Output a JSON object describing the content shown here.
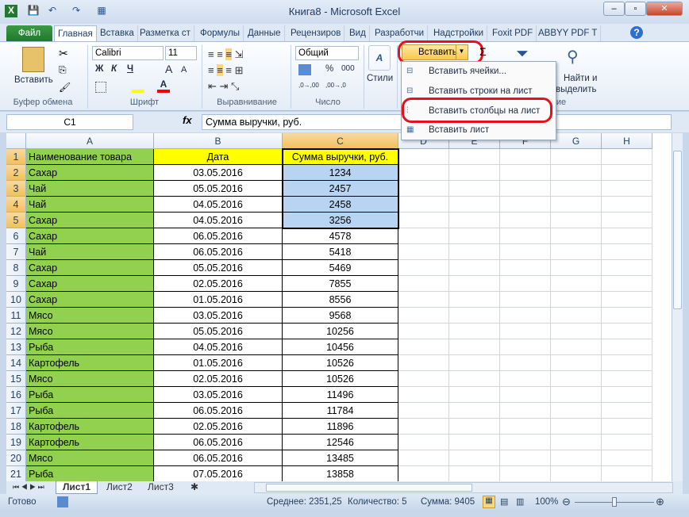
{
  "window": {
    "title": "Книга8 - Microsoft Excel",
    "minimize": "‒",
    "maximize": "▫",
    "close": "✕"
  },
  "qat": {
    "excel_icon": "X",
    "save": "💾",
    "undo": "↶",
    "redo": "↷",
    "form": "▦"
  },
  "tabs": [
    "Файл",
    "Главная",
    "Вставка",
    "Разметка ст",
    "Формулы",
    "Данные",
    "Рецензиров",
    "Вид",
    "Разработчи",
    "Надстройки",
    "Foxit PDF",
    "ABBYY PDF T"
  ],
  "ribbon": {
    "clipboard": {
      "paste": "Вставить",
      "group": "Буфер обмена"
    },
    "font": {
      "name": "Calibri",
      "size": "11",
      "bold": "Ж",
      "italic": "К",
      "underline": "Ч",
      "grow": "A",
      "shrink": "A",
      "group": "Шрифт",
      "fill_color": "#ffff00",
      "font_color": "#ff0000"
    },
    "alignment": {
      "group": "Выравнивание"
    },
    "number": {
      "format": "Общий",
      "percent": "%",
      "thousands": "000",
      "inc": ",0→,00",
      "dec": ",00→,0",
      "group": "Число"
    },
    "styles": {
      "label": "Стили"
    },
    "cells": {
      "insert": "Вставить",
      "group_partial": "ние"
    },
    "editing": {
      "sigma": "Σ",
      "find": "Найти и",
      "select": "выделить"
    }
  },
  "insert_menu": {
    "items": [
      "Вставить ячейки...",
      "Вставить строки на лист",
      "Вставить столбцы на лист",
      "Вставить лист"
    ],
    "highlighted": "Вставить столбцы на лист",
    "ring_color": "#e8101a"
  },
  "formula_bar": {
    "name_box": "C1",
    "fx": "fx",
    "value": "Сумма выручки, руб."
  },
  "columns": [
    "A",
    "B",
    "C",
    "D",
    "E",
    "F",
    "G",
    "H"
  ],
  "selected_column": "C",
  "rows": [
    [
      "Наименование товара",
      "Дата",
      "Сумма выручки, руб."
    ],
    [
      "Сахар",
      "03.05.2016",
      "1234"
    ],
    [
      "Чай",
      "05.05.2016",
      "2457"
    ],
    [
      "Чай",
      "04.05.2016",
      "2458"
    ],
    [
      "Сахар",
      "04.05.2016",
      "3256"
    ],
    [
      "Сахар",
      "06.05.2016",
      "4578"
    ],
    [
      "Чай",
      "06.05.2016",
      "5418"
    ],
    [
      "Сахар",
      "05.05.2016",
      "5469"
    ],
    [
      "Сахар",
      "02.05.2016",
      "7855"
    ],
    [
      "Сахар",
      "01.05.2016",
      "8556"
    ],
    [
      "Мясо",
      "03.05.2016",
      "9568"
    ],
    [
      "Мясо",
      "05.05.2016",
      "10256"
    ],
    [
      "Рыба",
      "04.05.2016",
      "10456"
    ],
    [
      "Картофель",
      "01.05.2016",
      "10526"
    ],
    [
      "Мясо",
      "02.05.2016",
      "10526"
    ],
    [
      "Рыба",
      "03.05.2016",
      "11496"
    ],
    [
      "Рыба",
      "06.05.2016",
      "11784"
    ],
    [
      "Картофель",
      "02.05.2016",
      "11896"
    ],
    [
      "Картофель",
      "06.05.2016",
      "12546"
    ],
    [
      "Мясо",
      "06.05.2016",
      "13485"
    ],
    [
      "Рыба",
      "07.05.2016",
      "13858"
    ]
  ],
  "colors": {
    "col_a": "#92d050",
    "header": "#ffff00",
    "selection": "#b8d4f2"
  },
  "sheets": [
    "Лист1",
    "Лист2",
    "Лист3"
  ],
  "active_sheet": "Лист1",
  "status": {
    "ready": "Готово",
    "average": "Среднее: 2351,25",
    "count": "Количество: 5",
    "sum": "Сумма: 9405",
    "zoom": "100%",
    "zoom_level": 100
  }
}
